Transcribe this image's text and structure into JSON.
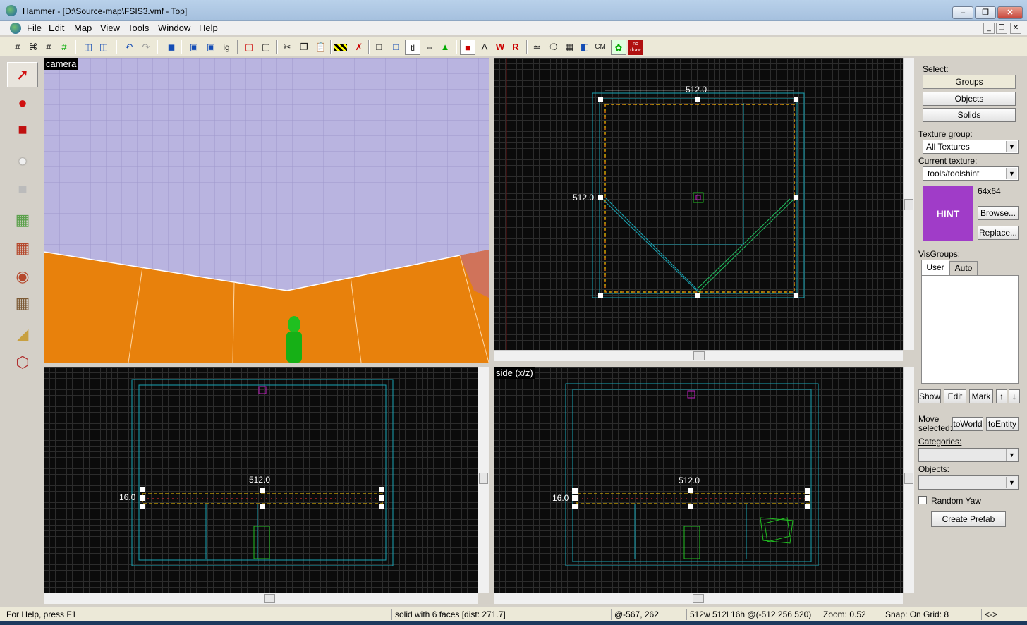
{
  "window": {
    "title": "Hammer - [D:\\Source-map\\FSIS3.vmf - Top]"
  },
  "menu": [
    "File",
    "Edit",
    "Map",
    "View",
    "Tools",
    "Window",
    "Help"
  ],
  "toolbar": {
    "tool_ig": "ig",
    "tool_cm": "CM",
    "tool_nodraw": "no draw",
    "tool_tl": "tl"
  },
  "views": {
    "camera_label": "camera",
    "side_label": "side (x/z)",
    "top_measure_w": "512.0",
    "top_measure_h": "512.0",
    "front_measure_w": "512.0",
    "front_measure_h": "16.0",
    "side_measure_w": "512.0",
    "side_measure_h": "16.0"
  },
  "panel": {
    "select_label": "Select:",
    "groups": "Groups",
    "objects": "Objects",
    "solids": "Solids",
    "texture_group_label": "Texture group:",
    "texture_group_value": "All Textures",
    "current_texture_label": "Current texture:",
    "current_texture_value": "tools/toolshint",
    "texture_preview_text": "HINT",
    "texture_size": "64x64",
    "browse": "Browse...",
    "replace": "Replace...",
    "visgroups_label": "VisGroups:",
    "tab_user": "User",
    "tab_auto": "Auto",
    "show": "Show",
    "edit": "Edit",
    "mark": "Mark",
    "move_selected_label1": "Move",
    "move_selected_label2": "selected:",
    "to_world": "toWorld",
    "to_entity": "toEntity",
    "categories_label": "Categories:",
    "objects_label": "Objects:",
    "random_yaw": "Random Yaw",
    "create_prefab": "Create Prefab"
  },
  "status": {
    "help": "For Help, press F1",
    "selection": "solid with 6 faces   [dist: 271.7]",
    "coords": "@-567, 262",
    "size": "512w 512l 16h @(-512 256 520)",
    "zoom": "Zoom: 0.52",
    "snap": "Snap: On Grid: 8",
    "extra": "<->"
  },
  "colors": {
    "hint_texture": "#a03cc8",
    "floor": "#e8810c",
    "sky": "#b9b4e0",
    "selection": "#ffcc00"
  },
  "icons": [
    "app-logo-icon",
    "grid-icon",
    "undo-icon",
    "redo-icon",
    "cut-icon",
    "copy-icon",
    "paste-icon",
    "selection-tool-icon",
    "magnify-tool-icon",
    "camera-tool-icon",
    "entity-tool-icon",
    "block-tool-icon",
    "texture-tool-icon",
    "apply-decal-icon",
    "overlay-tool-icon",
    "clipping-tool-icon",
    "vertex-tool-icon"
  ]
}
